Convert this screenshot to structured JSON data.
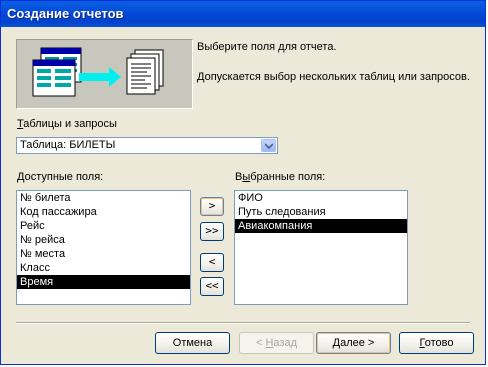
{
  "window": {
    "title": "Создание отчетов"
  },
  "intro": {
    "line1": "Выберите поля для отчета.",
    "line2": "Допускается выбор нескольких таблиц или запросов."
  },
  "source": {
    "label": "Таблицы и запросы",
    "label_underline_char": "Т",
    "label_rest": "аблицы и запросы",
    "selected": "Таблица: БИЛЕТЫ"
  },
  "available": {
    "label_underline_char": "Д",
    "label_rest": "оступные поля:",
    "items": [
      "№ билета",
      "Код пассажира",
      "Рейс",
      "№ рейса",
      "№ места",
      "Класс",
      "Время"
    ],
    "selected_index": 6
  },
  "selected_fields": {
    "label_pre": "В",
    "label_underline_char": "ы",
    "label_rest": "бранные поля:",
    "items": [
      "ФИО",
      "Путь следования",
      "Авиакомпания"
    ],
    "selected_index": 2
  },
  "move_buttons": {
    "add_one": ">",
    "add_all": ">>",
    "remove_one": "<",
    "remove_all": "<<"
  },
  "footer": {
    "cancel": "Отмена",
    "back_pre": "< ",
    "back_ul": "Н",
    "back_rest": "азад",
    "next_ul": "Д",
    "next_rest": "алее >",
    "finish_ul": "Г",
    "finish_rest": "отово"
  }
}
